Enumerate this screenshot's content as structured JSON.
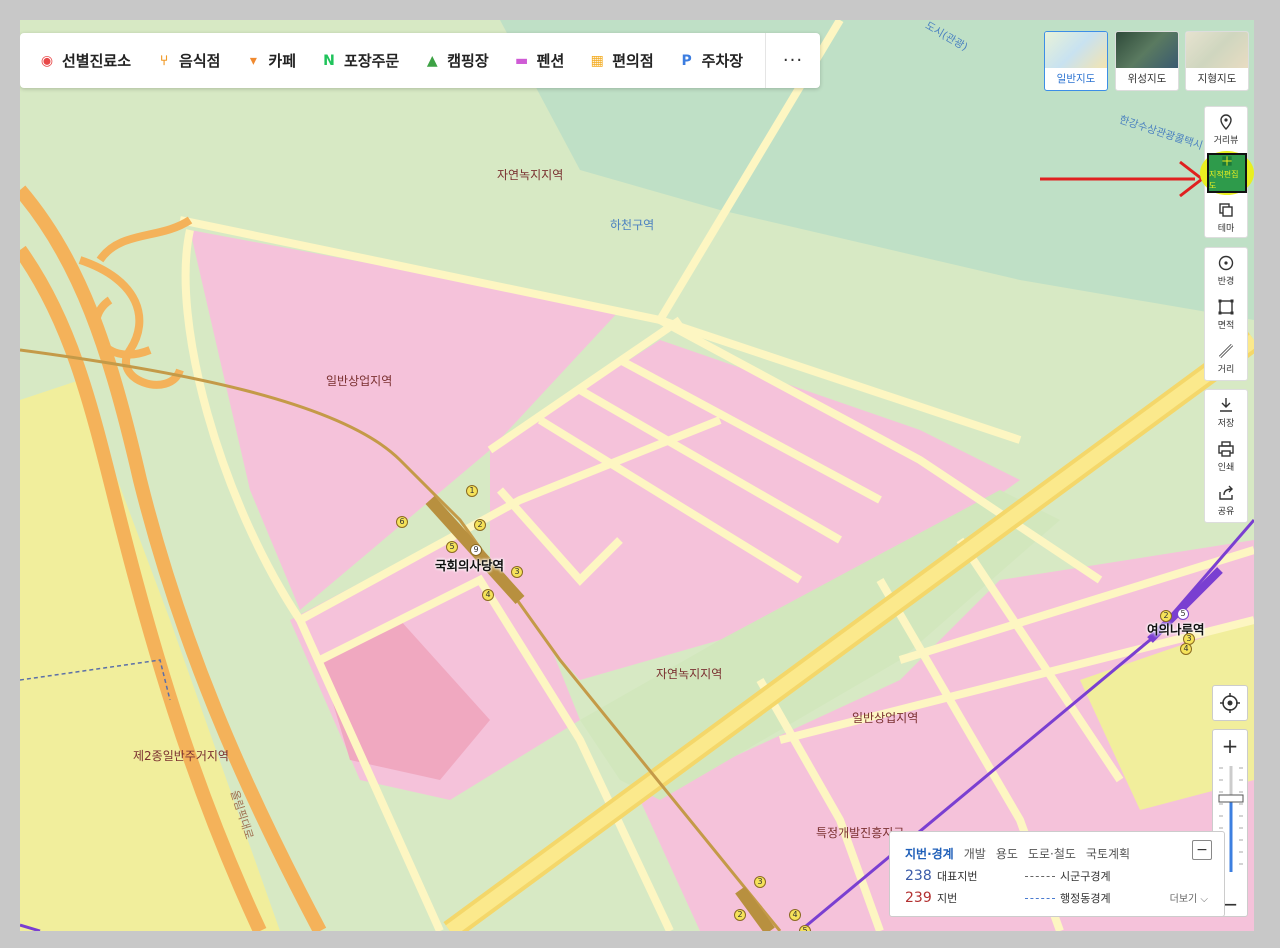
{
  "categories": [
    {
      "label": "선별진료소",
      "icon": "pin-icon",
      "color": "#e84848"
    },
    {
      "label": "음식점",
      "icon": "fork-knife-icon",
      "color": "#f09a28"
    },
    {
      "label": "카페",
      "icon": "cup-icon",
      "color": "#f08a30"
    },
    {
      "label": "포장주문",
      "icon": "n-icon",
      "color": "#1fc35b"
    },
    {
      "label": "캠핑장",
      "icon": "tent-icon",
      "color": "#3da245"
    },
    {
      "label": "펜션",
      "icon": "bed-icon",
      "color": "#cf5bd5"
    },
    {
      "label": "편의점",
      "icon": "store-icon",
      "color": "#f3ab1f"
    },
    {
      "label": "주차장",
      "icon": "parking-icon",
      "color": "#3c7de0"
    }
  ],
  "more_label": "···",
  "map_types": [
    {
      "label": "일반지도",
      "active": true
    },
    {
      "label": "위성지도",
      "active": false
    },
    {
      "label": "지형지도",
      "active": false
    }
  ],
  "tools": {
    "group1": [
      {
        "label": "거리뷰",
        "icon": "streetview-pin-icon"
      },
      {
        "label": "지적편집도",
        "icon": "cadastral-map-icon",
        "highlighted": true
      },
      {
        "label": "테마",
        "icon": "theme-layers-icon"
      }
    ],
    "group2": [
      {
        "label": "반경",
        "icon": "radius-icon"
      },
      {
        "label": "면적",
        "icon": "area-icon"
      },
      {
        "label": "거리",
        "icon": "ruler-icon"
      }
    ],
    "group3": [
      {
        "label": "저장",
        "icon": "download-icon"
      },
      {
        "label": "인쇄",
        "icon": "print-icon"
      },
      {
        "label": "공유",
        "icon": "share-icon"
      }
    ]
  },
  "zoom": {
    "plus": "+",
    "minus": "−"
  },
  "map_labels": {
    "zone_green_top": "자연녹지지역",
    "river_zone": "하천구역",
    "commercial_left": "일반상업지역",
    "station_main": "국회의사당역",
    "green_center": "자연녹지지역",
    "commercial_right": "일반상업지역",
    "residential": "제2종일반주거지역",
    "special_dev": "특정개발진흥지구",
    "station_right": "여의나루역",
    "road_name": "올림픽대로",
    "river_park": "한강수상관광콜택시",
    "top_edge": "도시(관광)"
  },
  "exits_main": [
    "1",
    "2",
    "3",
    "4",
    "5",
    "6",
    "9"
  ],
  "exits_bottom": [
    "3",
    "2",
    "4",
    "5"
  ],
  "exits_right": [
    "2",
    "5",
    "3",
    "4"
  ],
  "legend": {
    "tabs": [
      "지번·경계",
      "개발",
      "용도",
      "도로·철도",
      "국토계획"
    ],
    "active_tab": "지번·경계",
    "collapse": "−",
    "rows": [
      {
        "num": "238",
        "label": "대표지번",
        "line": "시군구경계"
      },
      {
        "num": "239",
        "label": "지번",
        "line": "행정동경계"
      }
    ],
    "more": "더보기 ⌵"
  },
  "colors": {
    "commercial": "#f5c2da",
    "green": "#cfe6b8",
    "residential": "#f2ef9a",
    "road": "#fdf6c2",
    "highway": "#f4b25a",
    "subway_line9": "#c49a48",
    "subway_line5": "#7a3fd1",
    "annotation_arrow": "#e02020",
    "highlight": "#e9ef20"
  }
}
